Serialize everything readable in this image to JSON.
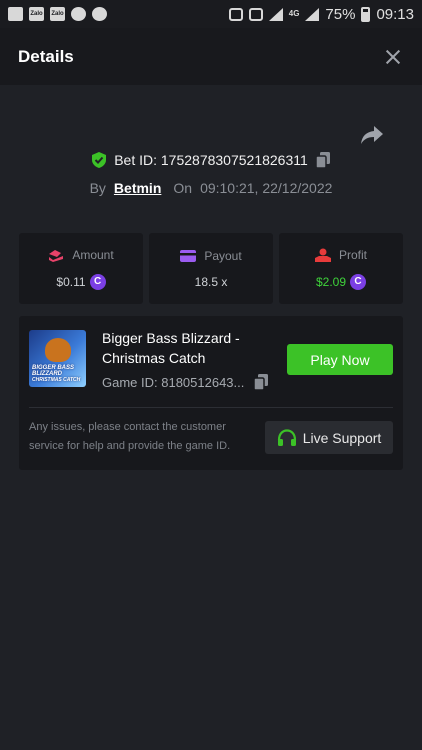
{
  "status_bar": {
    "notifications": [
      "chat-icon",
      "zalo-icon",
      "zalo-icon",
      "account-icon",
      "timer-icon"
    ],
    "zalo_label": "Zalo",
    "network": "4G",
    "battery": "75%",
    "time": "09:13"
  },
  "header": {
    "title": "Details"
  },
  "bet": {
    "id_label": "Bet ID: 1752878307521826311",
    "by_label": "By",
    "user": "Betmin",
    "on_label": "On",
    "datetime": "09:10:21, 22/12/2022"
  },
  "stats": [
    {
      "label": "Amount",
      "value": "$0.11",
      "icon": "amount-icon",
      "value_color": "#cfd2d6"
    },
    {
      "label": "Payout",
      "value": "18.5 x",
      "icon": "payout-card-icon",
      "value_color": "#cfd2d6"
    },
    {
      "label": "Profit",
      "value": "$2.09",
      "icon": "profit-icon",
      "value_color": "#3fd23b"
    }
  ],
  "coin_symbol": "C",
  "game": {
    "title": "Bigger Bass Blizzard - Christmas Catch",
    "thumb_text_1": "BIGGER BASS",
    "thumb_text_2": "BLIZZARD",
    "thumb_text_3": "CHRISTMAS CATCH",
    "game_id": "Game ID: 8180512643...",
    "play_label": "Play Now",
    "notice": "Any issues, please contact the customer service for help and provide the game ID.",
    "support_label": "Live Support"
  },
  "colors": {
    "accent_green": "#3cc227",
    "coin_purple": "#7b3fe4",
    "background": "#1f2126"
  }
}
